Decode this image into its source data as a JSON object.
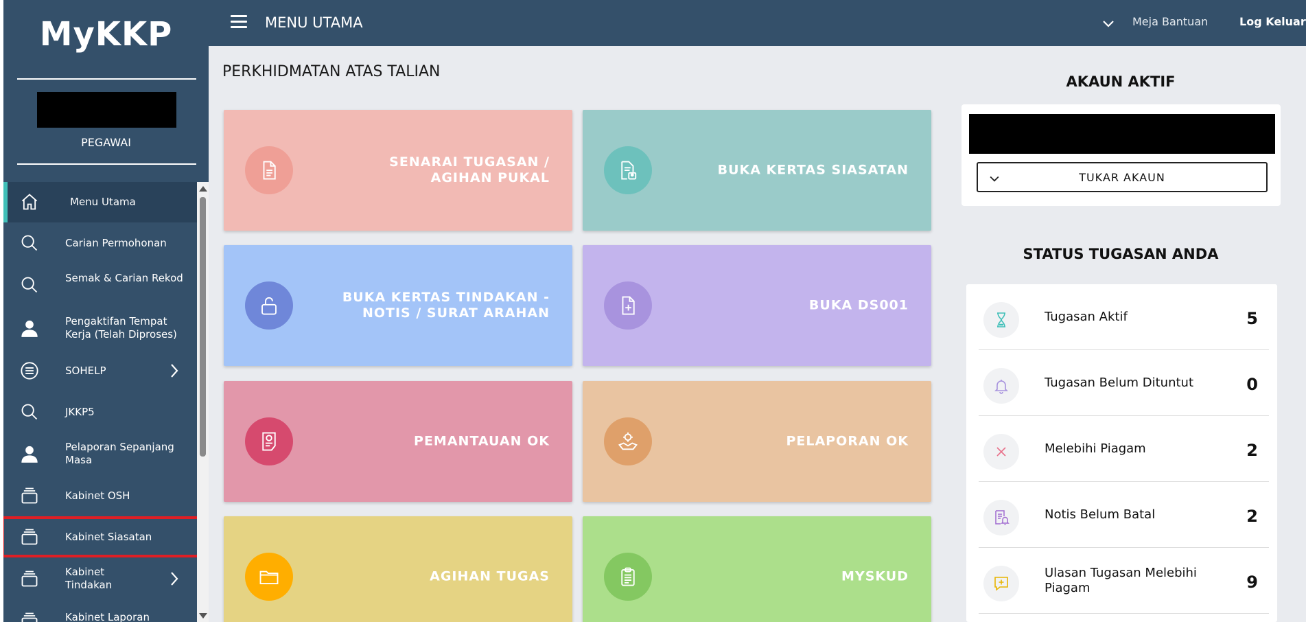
{
  "app": {
    "logo": "MyKKP",
    "role": "PEGAWAI"
  },
  "topbar": {
    "title": "MENU UTAMA",
    "help": "Meja Bantuan",
    "logout": "Log Keluar"
  },
  "sidebar": {
    "items": [
      {
        "label": "Menu Utama",
        "icon": "home-icon"
      },
      {
        "label": "Carian Permohonan",
        "icon": "search-icon"
      },
      {
        "label": "Semak & Carian Rekod",
        "icon": "search-icon"
      },
      {
        "label": "Pengaktifan Tempat Kerja (Telah Diproses)",
        "icon": "user-icon"
      },
      {
        "label": "SOHELP",
        "icon": "list-icon"
      },
      {
        "label": "JKKP5",
        "icon": "search-icon"
      },
      {
        "label": "Pelaporan Sepanjang Masa",
        "icon": "user-icon"
      },
      {
        "label": "Kabinet OSH",
        "icon": "cabinet-icon"
      },
      {
        "label": "Kabinet Siasatan",
        "icon": "cabinet-icon"
      },
      {
        "label": "Kabinet Tindakan",
        "icon": "cabinet-icon"
      },
      {
        "label": "Kabinet Laporan",
        "icon": "cabinet-icon"
      }
    ]
  },
  "main": {
    "section_title": "PERKHIDMATAN ATAS TALIAN",
    "tiles": [
      {
        "label": "SENARAI TUGASAN / AGIHAN PUKAL",
        "icon": "document-icon",
        "bg": "#f2bab4",
        "circle": "#ef9f96"
      },
      {
        "label": "BUKA KERTAS SIASATAN",
        "icon": "document-user-icon",
        "bg": "#9acbc9",
        "circle": "#6dc1bc"
      },
      {
        "label": "BUKA KERTAS TINDAKAN - NOTIS / SURAT ARAHAN",
        "icon": "unlock-icon",
        "bg": "#a3c4f8",
        "circle": "#6f87d9"
      },
      {
        "label": "BUKA DS001",
        "icon": "file-plus-icon",
        "bg": "#c3b4ed",
        "circle": "#a893de"
      },
      {
        "label": "PEMANTAUAN OK",
        "icon": "certificate-icon",
        "bg": "#e297aa",
        "circle": "#d64a6e"
      },
      {
        "label": "PELAPORAN OK",
        "icon": "handshake-gear-icon",
        "bg": "#e9c4a1",
        "circle": "#dfa06a"
      },
      {
        "label": "AGIHAN TUGAS",
        "icon": "folder-icon",
        "bg": "#e5d383",
        "circle": "#ffae00"
      },
      {
        "label": "MYSKUD",
        "icon": "clipboard-icon",
        "bg": "#acdf8b",
        "circle": "#84c861"
      }
    ]
  },
  "account": {
    "title": "AKAUN AKTIF",
    "switch_label": "TUKAR AKAUN"
  },
  "status": {
    "title": "STATUS TUGASAN ANDA",
    "items": [
      {
        "label": "Tugasan Aktif",
        "count": "5",
        "icon": "hourglass-icon",
        "color": "#3fbfb8"
      },
      {
        "label": "Tugasan Belum Dituntut",
        "count": "0",
        "icon": "bell-icon",
        "color": "#a893de"
      },
      {
        "label": "Melebihi Piagam",
        "count": "2",
        "icon": "close-icon",
        "color": "#e8708a"
      },
      {
        "label": "Notis Belum Batal",
        "count": "2",
        "icon": "notice-icon",
        "color": "#a06ad0"
      },
      {
        "label": "Ulasan Tugasan Melebihi Piagam",
        "count": "9",
        "icon": "comment-plus-icon",
        "color": "#e8b400"
      }
    ]
  }
}
